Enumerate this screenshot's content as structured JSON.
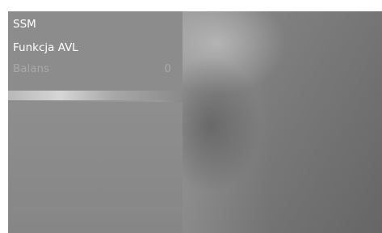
{
  "menu": {
    "items": [
      {
        "label": "SSM",
        "value": "",
        "enabled": true
      },
      {
        "label": "Funkcja AVL",
        "value": "",
        "enabled": true
      },
      {
        "label": "Balans",
        "value": "0",
        "enabled": false
      }
    ]
  },
  "colors": {
    "menu_background": "#8c8c8c",
    "text_enabled": "#ffffff",
    "text_disabled": "#a9a9a9"
  }
}
